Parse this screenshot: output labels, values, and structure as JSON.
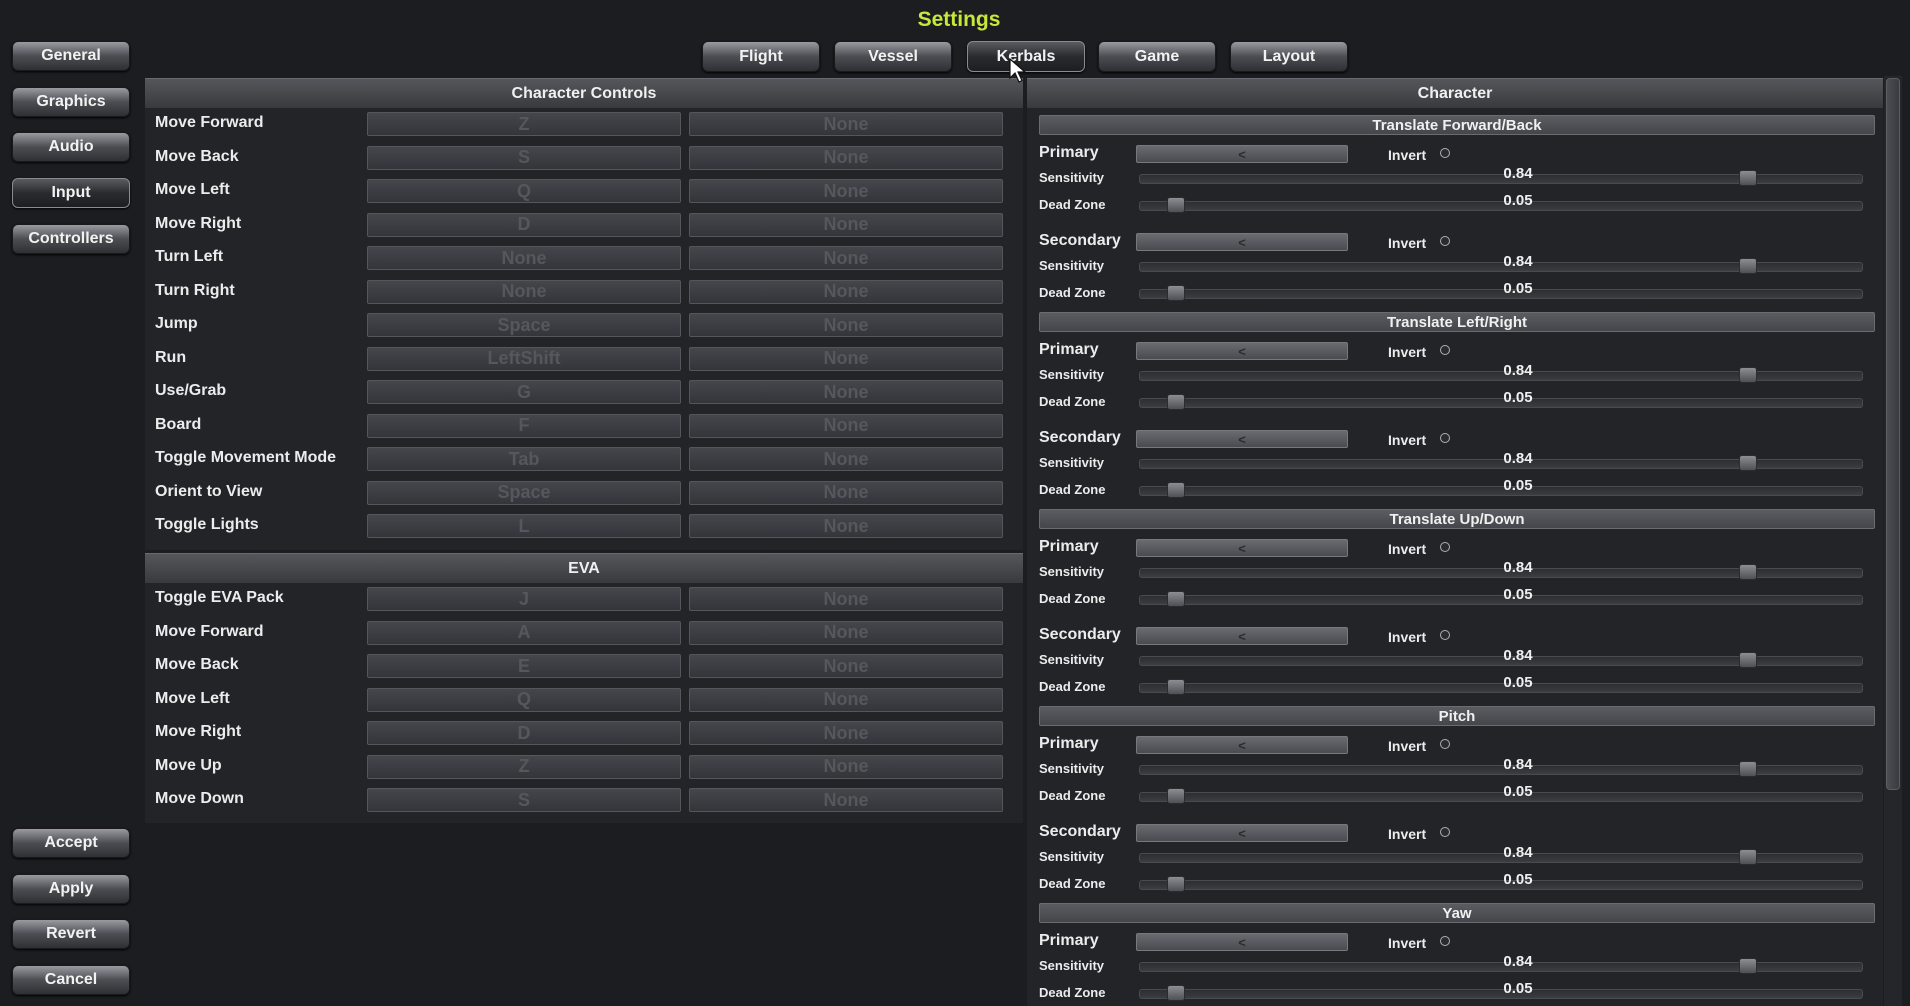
{
  "title": "Settings",
  "nav": {
    "items": [
      "General",
      "Graphics",
      "Audio",
      "Input",
      "Controllers"
    ],
    "active": "Input",
    "actions": [
      "Accept",
      "Apply",
      "Revert",
      "Cancel"
    ]
  },
  "tabs": {
    "items": [
      "Flight",
      "Vessel",
      "Kerbals",
      "Game",
      "Layout"
    ],
    "active": "Kerbals"
  },
  "left": {
    "header": "Character Controls",
    "rows": [
      {
        "label": "Move Forward",
        "primary": "Z",
        "secondary": "None"
      },
      {
        "label": "Move Back",
        "primary": "S",
        "secondary": "None"
      },
      {
        "label": "Move Left",
        "primary": "Q",
        "secondary": "None"
      },
      {
        "label": "Move Right",
        "primary": "D",
        "secondary": "None"
      },
      {
        "label": "Turn Left",
        "primary": "None",
        "secondary": "None"
      },
      {
        "label": "Turn Right",
        "primary": "None",
        "secondary": "None"
      },
      {
        "label": "Jump",
        "primary": "Space",
        "secondary": "None"
      },
      {
        "label": "Run",
        "primary": "LeftShift",
        "secondary": "None"
      },
      {
        "label": "Use/Grab",
        "primary": "G",
        "secondary": "None"
      },
      {
        "label": "Board",
        "primary": "F",
        "secondary": "None"
      },
      {
        "label": "Toggle Movement Mode",
        "primary": "Tab",
        "secondary": "None"
      },
      {
        "label": "Orient to View",
        "primary": "Space",
        "secondary": "None"
      },
      {
        "label": "Toggle Lights",
        "primary": "L",
        "secondary": "None"
      }
    ],
    "eva_header": "EVA",
    "eva_rows": [
      {
        "label": "Toggle EVA Pack",
        "primary": "J",
        "secondary": "None"
      },
      {
        "label": "Move Forward",
        "primary": "A",
        "secondary": "None"
      },
      {
        "label": "Move Back",
        "primary": "E",
        "secondary": "None"
      },
      {
        "label": "Move Left",
        "primary": "Q",
        "secondary": "None"
      },
      {
        "label": "Move Right",
        "primary": "D",
        "secondary": "None"
      },
      {
        "label": "Move Up",
        "primary": "Z",
        "secondary": "None"
      },
      {
        "label": "Move Down",
        "primary": "S",
        "secondary": "None"
      }
    ]
  },
  "right": {
    "header": "Character",
    "labels": {
      "primary": "Primary",
      "secondary": "Secondary",
      "invert": "Invert",
      "sensitivity": "Sensitivity",
      "deadzone": "Dead Zone",
      "axis_placeholder": "<"
    },
    "sections": [
      {
        "title": "Translate Forward/Back",
        "primary": {
          "sensitivity": "0.84",
          "deadzone": "0.05",
          "sens_level": 0.84,
          "dz_level": 0.05
        },
        "secondary": {
          "sensitivity": "0.84",
          "deadzone": "0.05",
          "sens_level": 0.84,
          "dz_level": 0.05
        }
      },
      {
        "title": "Translate Left/Right",
        "primary": {
          "sensitivity": "0.84",
          "deadzone": "0.05",
          "sens_level": 0.84,
          "dz_level": 0.05
        },
        "secondary": {
          "sensitivity": "0.84",
          "deadzone": "0.05",
          "sens_level": 0.84,
          "dz_level": 0.05
        }
      },
      {
        "title": "Translate Up/Down",
        "primary": {
          "sensitivity": "0.84",
          "deadzone": "0.05",
          "sens_level": 0.84,
          "dz_level": 0.05
        },
        "secondary": {
          "sensitivity": "0.84",
          "deadzone": "0.05",
          "sens_level": 0.84,
          "dz_level": 0.05
        }
      },
      {
        "title": "Pitch",
        "primary": {
          "sensitivity": "0.84",
          "deadzone": "0.05",
          "sens_level": 0.84,
          "dz_level": 0.05
        },
        "secondary": {
          "sensitivity": "0.84",
          "deadzone": "0.05",
          "sens_level": 0.84,
          "dz_level": 0.05
        }
      },
      {
        "title": "Yaw",
        "primary": {
          "sensitivity": "0.84",
          "deadzone": "0.05",
          "sens_level": 0.84,
          "dz_level": 0.05
        }
      }
    ]
  }
}
